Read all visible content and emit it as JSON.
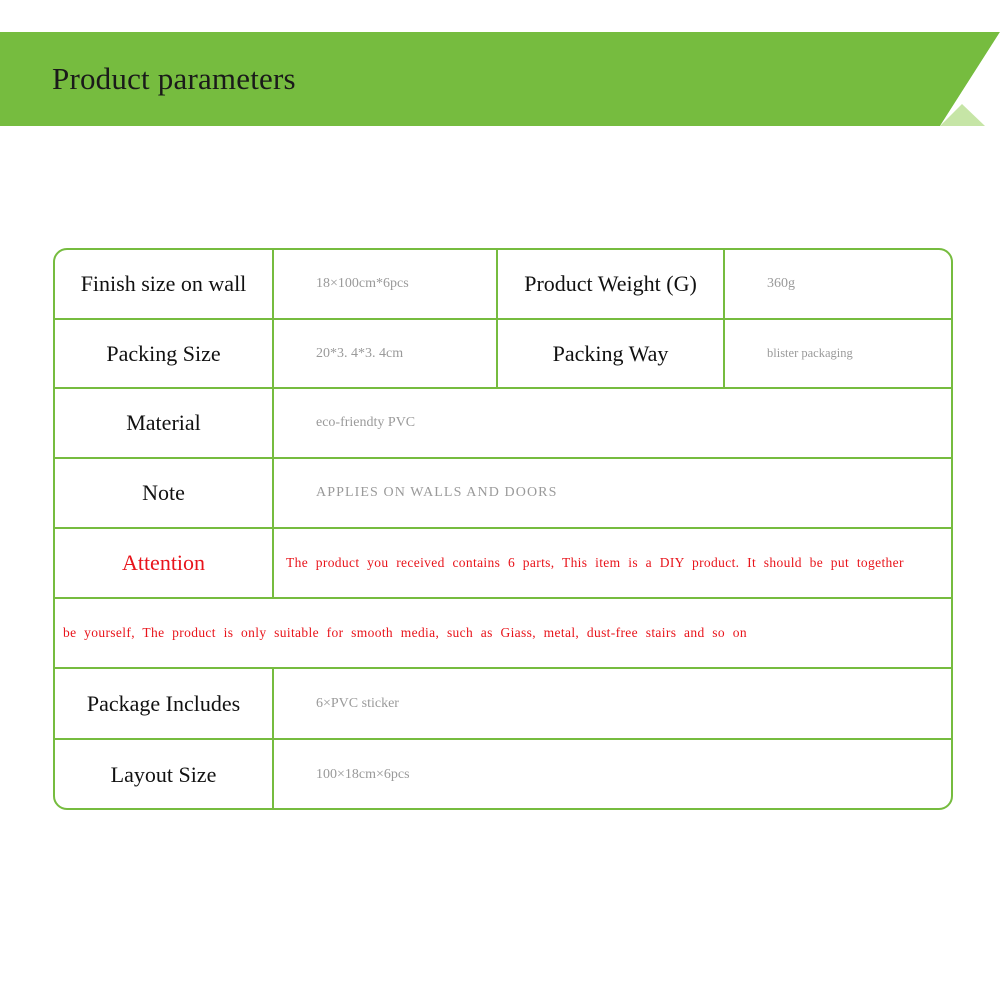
{
  "banner": {
    "title": "Product parameters",
    "color_main": "#76bc3f",
    "color_fold": "#c6e5a6"
  },
  "table": {
    "border_color": "#76bc3f",
    "rows": [
      {
        "type": "four-cell",
        "label1": "Finish size on wall",
        "value1": "18×100cm*6pcs",
        "label2": "Product Weight (G)",
        "value2": "360g"
      },
      {
        "type": "four-cell",
        "label1": "Packing Size",
        "value1": "20*3. 4*3. 4cm",
        "label2": "Packing Way",
        "value2": "blister packaging"
      },
      {
        "type": "two-cell",
        "label1": "Material",
        "value1": "eco-friendty PVC"
      },
      {
        "type": "two-cell",
        "label1": "Note",
        "value1": "APPLIES  ON  WALLS  AND DOORS"
      },
      {
        "type": "attention",
        "label1": "Attention",
        "value1": "The  product  you  received  contains  6  parts, This  item  is  a  DIY  product. It  should  be  put  together"
      },
      {
        "type": "full-red",
        "value1": "be  yourself, The  product  is  only  suitable  for  smooth  media,  such  as  Giass, metal, dust-free  stairs  and  so  on"
      },
      {
        "type": "two-cell",
        "label1": "Package Includes",
        "value1": "6×PVC sticker"
      },
      {
        "type": "two-cell",
        "label1": "Layout Size",
        "value1": "100×18cm×6pcs"
      }
    ]
  }
}
